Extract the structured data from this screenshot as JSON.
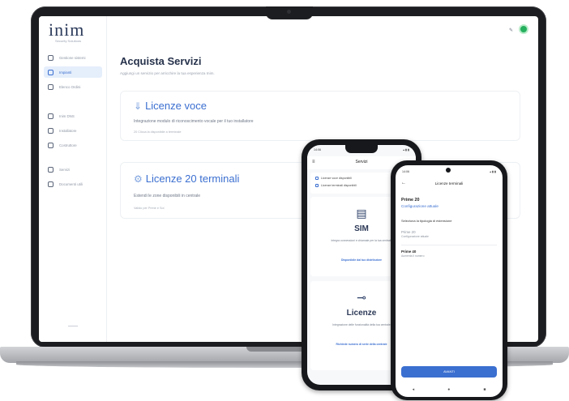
{
  "laptop": {
    "logo_text": "inim",
    "logo_sub": "Security Solutions",
    "sidebar": {
      "items": [
        {
          "label": "Gestione sistemi",
          "icon": "box-icon"
        },
        {
          "label": "Impianti",
          "icon": "grid-icon"
        },
        {
          "label": "Elenco Ordini",
          "icon": "cart-icon"
        },
        {
          "label": "Inim DNS",
          "icon": "dns-icon"
        },
        {
          "label": "Installatore",
          "icon": "user-icon"
        },
        {
          "label": "Costruttore",
          "icon": "building-icon"
        },
        {
          "label": "Servizi",
          "icon": "gear-icon"
        },
        {
          "label": "Documenti utili",
          "icon": "document-icon"
        }
      ],
      "active_index": 1
    },
    "page_title": "Acquista Servizi",
    "page_subtitle": "Aggiungi un servizio per arricchire la tua esperienza Inim.",
    "cards": [
      {
        "title": "Licenze voce",
        "description": "Integrazione modulo di riconoscimento vocale per il tuo installatore",
        "link": "20  Clicca la disponibile a terminale"
      },
      {
        "title": "Licenze 20 terminali",
        "description": "Estendi le zone disponibili in centrale",
        "link": "Valido per Prime e Sol"
      }
    ],
    "accent_color": "#3b6fd0",
    "avatar_color": "#25b05e"
  },
  "phone1": {
    "status_time": "14:06",
    "status_icons": "▴ ▮ ▮",
    "title": "Servizi",
    "info_lines": [
      "Licenze voce disponibili",
      "Licenze terminali disponibili"
    ],
    "cards": [
      {
        "title": "SIM",
        "description": "Integra connessioni e chiamate per la tua centrale",
        "note": "Disponibile dal tuo distributore"
      },
      {
        "title": "Licenze",
        "description": "Integrazione delle funzionalità della tua centrale",
        "note": "Richiede numero di serie della centrale"
      }
    ]
  },
  "phone2": {
    "status_time": "14:06",
    "status_icons": "▴ ▮ ▮",
    "title": "Licenze terminali",
    "heading": "Prime 20",
    "config_label": "Configurazione attuale",
    "select_label": "Seleziona la tipologia di estensione",
    "options": [
      {
        "title": "Prime 20",
        "subtitle": "Configurazione attuale"
      },
      {
        "title": "Prime 40",
        "subtitle": "Aumenta il numero"
      }
    ],
    "button_label": "AVANTI",
    "nav": [
      "◂",
      "●",
      "■"
    ]
  }
}
